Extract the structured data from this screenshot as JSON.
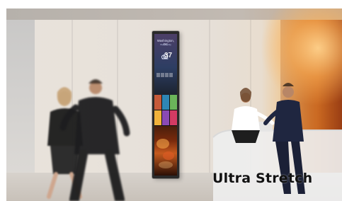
{
  "caption": {
    "text": "Ultra Stretch"
  },
  "display_screen": {
    "city": "Washington, DC",
    "subtitle": "Wednesday",
    "temperature": "37",
    "weather_icon": "cloudy-icon"
  },
  "colors": {
    "warm_wood": "#c4601c",
    "wall": "#e8e2da",
    "screen_bezel": "#2a2a2a",
    "caption_text": "#111111"
  }
}
